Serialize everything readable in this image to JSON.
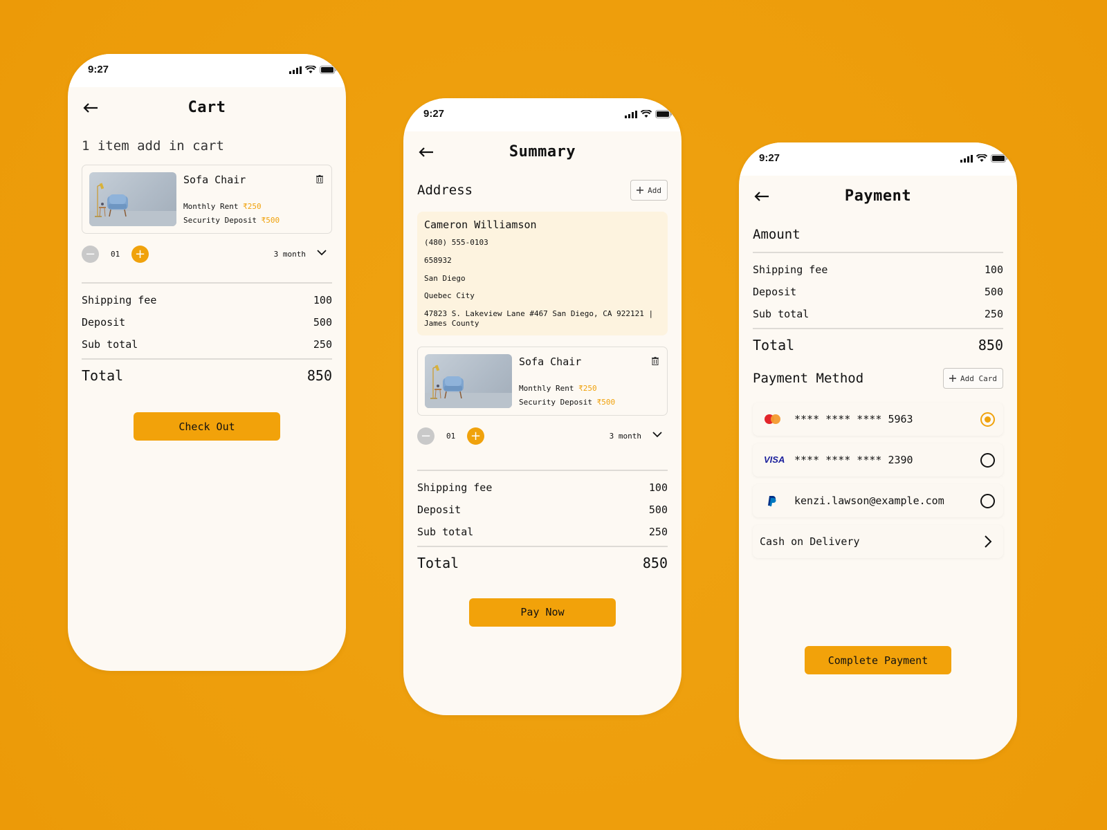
{
  "colors": {
    "background": "#EE9E0C",
    "accent": "#F0A20C",
    "card_bg": "#FDF9F3",
    "address_bg": "#FDF3DF"
  },
  "status_bar": {
    "time": "9:27"
  },
  "cart": {
    "title": "Cart",
    "subtitle": "1 item add in cart",
    "item": {
      "name": "Sofa Chair",
      "rent_label": "Monthly Rent",
      "rent_value": "₹250",
      "deposit_label": "Security Deposit",
      "deposit_value": "₹500"
    },
    "quantity": "01",
    "duration": "3 month",
    "rows": [
      {
        "label": "Shipping fee",
        "value": "100"
      },
      {
        "label": "Deposit",
        "value": "500"
      },
      {
        "label": "Sub total",
        "value": "250"
      }
    ],
    "total_label": "Total",
    "total_value": "850",
    "button": "Check Out"
  },
  "summary": {
    "title": "Summary",
    "address_title": "Address",
    "add_label": "Add",
    "address": {
      "name": "Cameron Williamson",
      "phone": "(480) 555-0103",
      "pin": "658932",
      "city": "San Diego",
      "state": "Quebec City",
      "street": "47823 S. Lakeview Lane #467 San Diego, CA 922121 | James County"
    },
    "item": {
      "name": "Sofa Chair",
      "rent_label": "Monthly Rent",
      "rent_value": "₹250",
      "deposit_label": "Security Deposit",
      "deposit_value": "₹500"
    },
    "quantity": "01",
    "duration": "3 month",
    "rows": [
      {
        "label": "Shipping fee",
        "value": "100"
      },
      {
        "label": "Deposit",
        "value": "500"
      },
      {
        "label": "Sub total",
        "value": "250"
      }
    ],
    "total_label": "Total",
    "total_value": "850",
    "button": "Pay Now"
  },
  "payment": {
    "title": "Payment",
    "amount_title": "Amount",
    "rows": [
      {
        "label": "Shipping fee",
        "value": "100"
      },
      {
        "label": "Deposit",
        "value": "500"
      },
      {
        "label": "Sub total",
        "value": "250"
      }
    ],
    "total_label": "Total",
    "total_value": "850",
    "method_title": "Payment Method",
    "add_card_label": "Add Card",
    "methods": [
      {
        "type": "mastercard",
        "icon": "mastercard-icon",
        "text": "**** **** **** 5963",
        "selected": true
      },
      {
        "type": "visa",
        "icon": "visa-icon",
        "logo_text": "VISA",
        "text": "**** **** **** 2390",
        "selected": false
      },
      {
        "type": "paypal",
        "icon": "paypal-icon",
        "text": "kenzi.lawson@example.com",
        "selected": false
      }
    ],
    "cod_label": "Cash on Delivery",
    "button": "Complete Payment"
  }
}
